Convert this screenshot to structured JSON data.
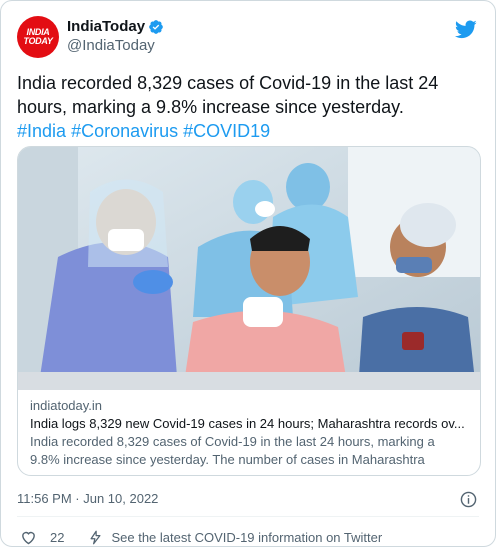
{
  "author": {
    "display_name": "IndiaToday",
    "handle": "@IndiaToday",
    "avatar_text_line1": "INDIA",
    "avatar_text_line2": "TODAY",
    "verified": true,
    "avatar_color": "#e30d13"
  },
  "tweet": {
    "text_line1": "India recorded 8,329 cases of Covid-19 in the last 24",
    "text_line2": "hours, marking a 9.8% increase since yesterday.",
    "hashtags": [
      "#India",
      "#Coronavirus",
      "#COVID19"
    ]
  },
  "card": {
    "domain": "indiatoday.in",
    "title": "India logs 8,329 new Covid-19 cases in 24 hours; Maharashtra records ov...",
    "description_line1": "India recorded 8,329 cases of Covid-19 in the last 24 hours, marking a",
    "description_line2": "9.8% increase since yesterday. The number of cases in Maharashtra"
  },
  "meta": {
    "timestamp": "11:56 PM · Jun 10, 2022",
    "info_icon": "info-icon"
  },
  "actions": {
    "like_count": "22",
    "covid_link": "See the latest COVID-19 information on Twitter"
  },
  "colors": {
    "link": "#1d9bf0",
    "secondary_text": "#536471",
    "border": "#cfd9de",
    "twitter_blue": "#1d9bf0"
  },
  "icons": [
    "verified-badge-icon",
    "twitter-bird-icon",
    "info-icon",
    "heart-icon",
    "lightning-icon"
  ]
}
